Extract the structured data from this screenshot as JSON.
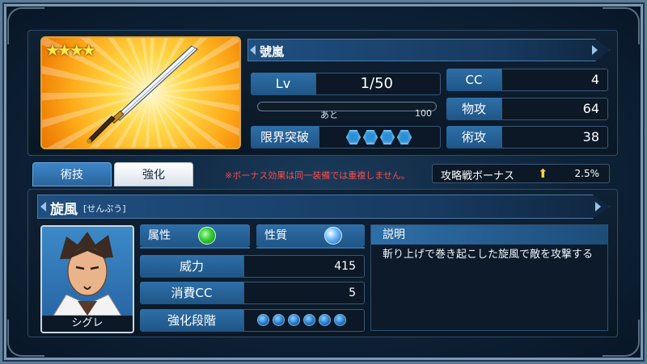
{
  "weapon": {
    "name": "號嵐",
    "rarity_stars": "★★★★",
    "level_label": "Lv",
    "level_value": "1/50",
    "exp_prefix": "あと",
    "exp_remaining": "100",
    "exp_progress": 0,
    "limit_break_label": "限界突破",
    "limit_break_gems": 4,
    "stats": {
      "cc_label": "CC",
      "cc_value": "4",
      "phys_label": "物攻",
      "phys_value": "64",
      "magic_label": "術攻",
      "magic_value": "38"
    }
  },
  "tabs": {
    "skill_label": "術技",
    "enhance_label": "強化"
  },
  "notice": "※ボーナス効果は同一装備では重複しません。",
  "bonus": {
    "label": "攻略戦ボーナス",
    "percent": "2.5%"
  },
  "skill": {
    "name": "旋風",
    "reading": "[せんぷう]",
    "character_name": "シグレ",
    "attribute_label": "属性",
    "attribute_icon": "wind-element-icon",
    "nature_label": "性質",
    "nature_icon": "orb-nature-icon",
    "power_label": "威力",
    "power_value": "415",
    "cost_label": "消費CC",
    "cost_value": "5",
    "enhance_label": "強化段階",
    "enhance_dots": 6,
    "desc_header": "説明",
    "description": "斬り上げで巻き起こした旋風で敵を攻撃する"
  },
  "colors": {
    "panel_bg": "#0c1826",
    "label_blue": "#2e6fa8",
    "notice_red": "#ff4a4a",
    "bonus_arrow": "#ffd53a"
  }
}
